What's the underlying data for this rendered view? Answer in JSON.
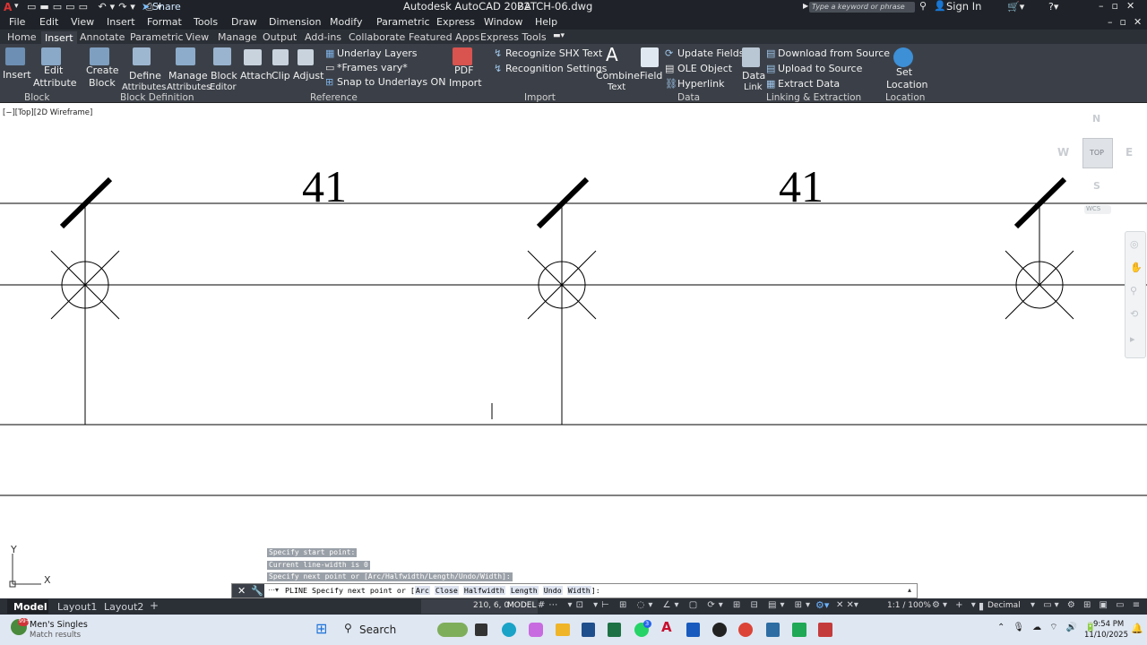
{
  "title_bar": {
    "app_title": "Autodesk AutoCAD 2022",
    "file_name": "BATCH-06.dwg",
    "share_label": "Share",
    "search_placeholder": "Type a keyword or phrase",
    "sign_in": "Sign In"
  },
  "menu": [
    "File",
    "Edit",
    "View",
    "Insert",
    "Format",
    "Tools",
    "Draw",
    "Dimension",
    "Modify",
    "Parametric",
    "Express",
    "Window",
    "Help"
  ],
  "ribbon_tabs": [
    "Home",
    "Insert",
    "Annotate",
    "Parametric",
    "View",
    "Manage",
    "Output",
    "Add-ins",
    "Collaborate",
    "Featured Apps",
    "Express Tools"
  ],
  "active_tab": "Insert",
  "ribbon": {
    "block_panel": {
      "insert": "Insert",
      "edit_attribute_1": "Edit",
      "edit_attribute_2": "Attribute",
      "title": "Block"
    },
    "block_def_panel": {
      "create_1": "Create",
      "create_2": "Block",
      "define_1": "Define",
      "define_2": "Attributes",
      "manage_1": "Manage",
      "manage_2": "Attributes",
      "block_1": "Block",
      "block_2": "Editor",
      "title": "Block Definition"
    },
    "reference_panel": {
      "attach": "Attach",
      "clip": "Clip",
      "adjust": "Adjust",
      "underlay_layers": "Underlay Layers",
      "frames_vary": "*Frames vary*",
      "snap_underlays": "Snap to Underlays ON",
      "title": "Reference"
    },
    "import_panel": {
      "pdf_1": "PDF",
      "pdf_2": "Import",
      "recognize_shx": "Recognize SHX Text",
      "recognition_settings": "Recognition Settings",
      "combine_1": "Combine",
      "combine_2": "Text",
      "title": "Import"
    },
    "data_panel": {
      "field": "Field",
      "update_fields": "Update Fields",
      "ole_object": "OLE Object",
      "hyperlink": "Hyperlink",
      "title": "Data"
    },
    "linking_panel": {
      "data_link_1": "Data",
      "data_link_2": "Link",
      "download": "Download from Source",
      "upload": "Upload to Source",
      "extract": "Extract  Data",
      "title": "Linking & Extraction"
    },
    "location_panel": {
      "set_1": "Set",
      "set_2": "Location",
      "title": "Location"
    }
  },
  "viewport_label": "[−][Top][2D Wireframe]",
  "viewcube": {
    "n": "N",
    "s": "S",
    "e": "E",
    "w": "W",
    "top": "TOP",
    "wcs": "WCS"
  },
  "drawing": {
    "label_1": "41",
    "label_2": "41"
  },
  "ucs": {
    "x": "X",
    "y": "Y"
  },
  "command_history": [
    "Specify start point:",
    "Current line-width is 0",
    "Specify next point or [Arc/Halfwidth/Length/Undo/Width]:"
  ],
  "command_line": {
    "prefix": "PLINE Specify next point or [",
    "options": [
      "Arc",
      "Close",
      "Halfwidth",
      "Length",
      "Undo",
      "Width"
    ],
    "suffix": "]:"
  },
  "layout_tabs": [
    "Model",
    "Layout1",
    "Layout2"
  ],
  "status_bar": {
    "coords": "210, 6, 0",
    "model": "MODEL",
    "scale": "1:1 / 100%",
    "units": "Decimal"
  },
  "taskbar": {
    "notification_title": "Men's Singles",
    "notification_sub": "Match results",
    "badge": "99+",
    "search": "Search",
    "time": "9:54 PM",
    "date": "11/10/2025",
    "whatsapp_badge": "3"
  }
}
